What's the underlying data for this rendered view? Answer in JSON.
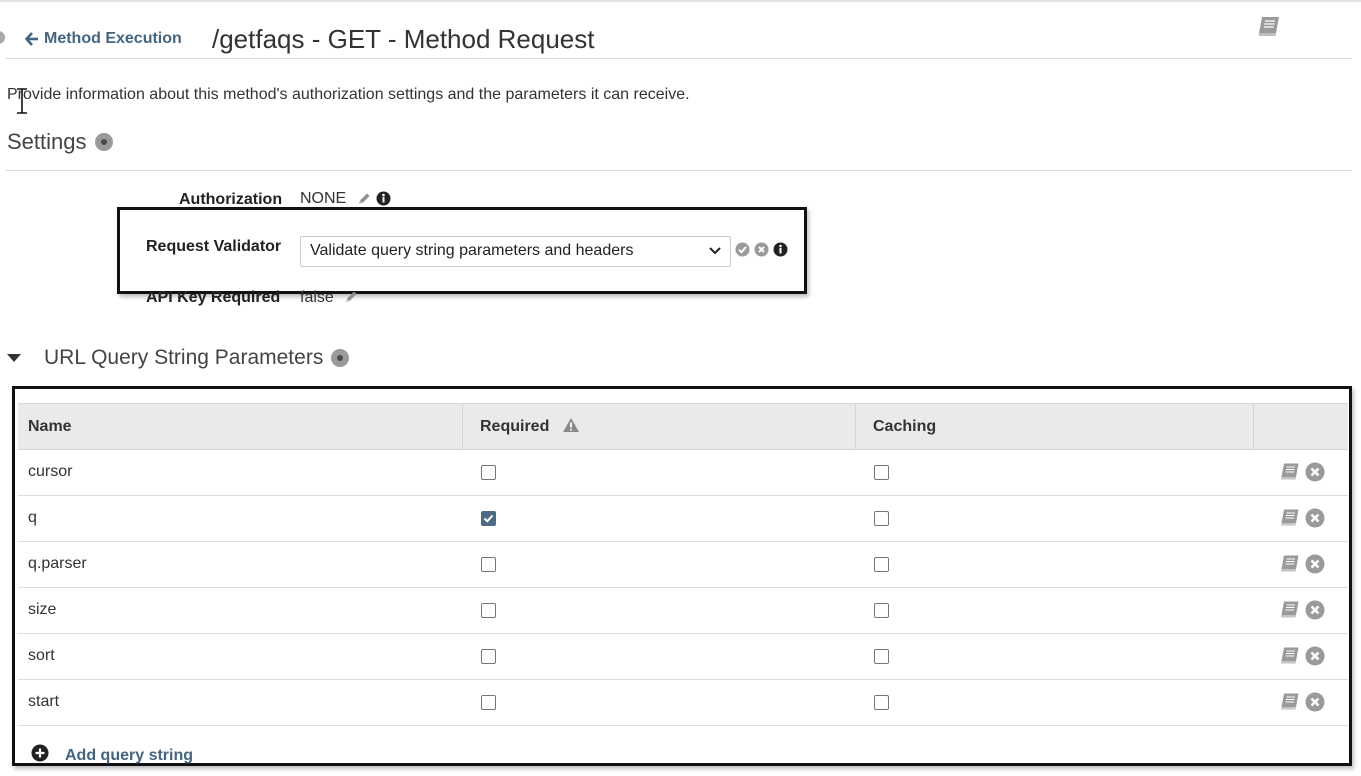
{
  "header": {
    "back_label": "Method Execution",
    "title": "/getfaqs - GET - Method Request",
    "icon_back": "arrow-left-icon",
    "icon_docs": "book-icon"
  },
  "description": "Provide information about this method's authorization settings and the parameters it can receive.",
  "settings": {
    "title": "Settings",
    "authorization": {
      "label": "Authorization",
      "value": "NONE"
    },
    "request_validator": {
      "label": "Request Validator",
      "selected": "Validate query string parameters and headers"
    },
    "api_key_required": {
      "label": "API Key Required",
      "value": "false"
    }
  },
  "query_params": {
    "title": "URL Query String Parameters",
    "columns": {
      "name": "Name",
      "required": "Required",
      "caching": "Caching"
    },
    "rows": [
      {
        "name": "cursor",
        "required": false,
        "caching": false
      },
      {
        "name": "q",
        "required": true,
        "caching": false
      },
      {
        "name": "q.parser",
        "required": false,
        "caching": false
      },
      {
        "name": "size",
        "required": false,
        "caching": false
      },
      {
        "name": "sort",
        "required": false,
        "caching": false
      },
      {
        "name": "start",
        "required": false,
        "caching": false
      }
    ],
    "add_label": "Add query string"
  },
  "colors": {
    "link": "#44647f",
    "checkbox_checked": "#4f6a85",
    "icon_gray": "#9a9a9a",
    "highlight_border": "#111111"
  }
}
